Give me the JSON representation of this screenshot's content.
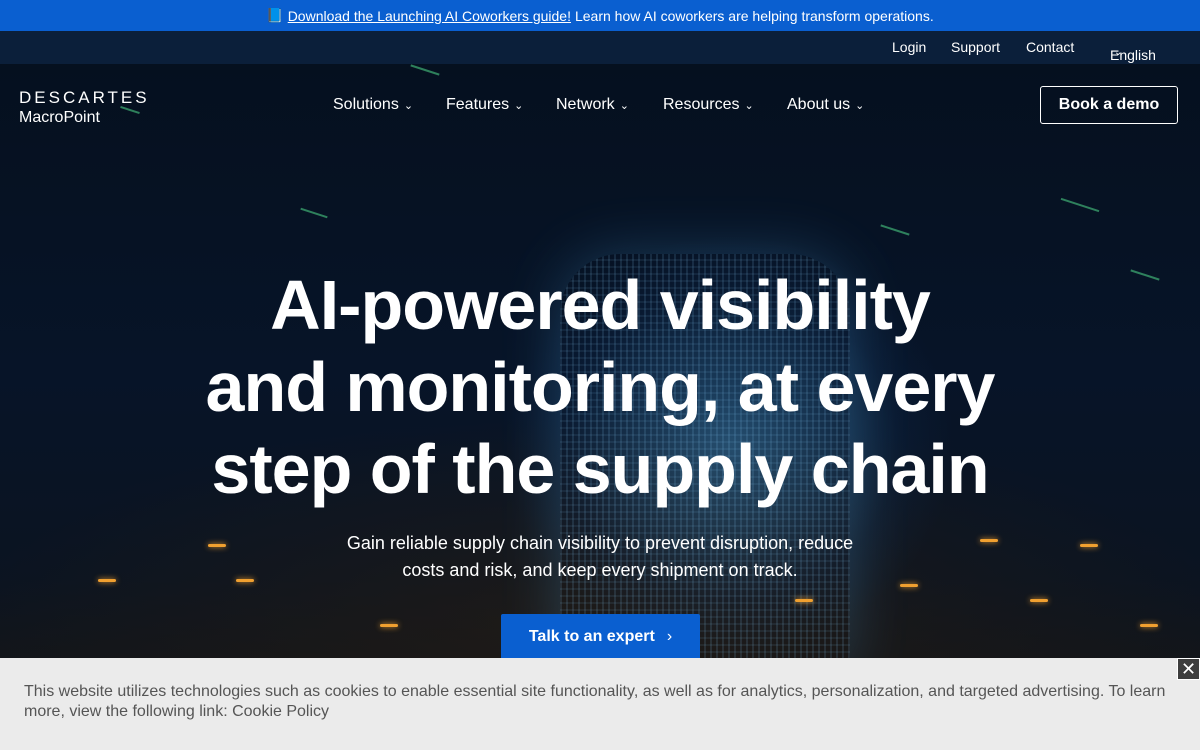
{
  "announcement": {
    "icon": "book-icon",
    "link_text": "Download the Launching AI Coworkers guide!",
    "text": "Learn how AI coworkers are helping transform operations."
  },
  "utility_nav": {
    "login": "Login",
    "support": "Support",
    "contact": "Contact",
    "language": "English"
  },
  "logo": {
    "line1": "DESCARTES",
    "line2": "MacroPoint"
  },
  "main_nav": {
    "items": [
      {
        "label": "Solutions"
      },
      {
        "label": "Features"
      },
      {
        "label": "Network"
      },
      {
        "label": "Resources"
      },
      {
        "label": "About us"
      }
    ],
    "cta": "Book a demo"
  },
  "hero": {
    "headline_line1": "AI-powered visibility",
    "headline_line2": "and monitoring, at every",
    "headline_line3": "step of the supply chain",
    "subtext_line1": "Gain reliable supply chain visibility to prevent disruption, reduce",
    "subtext_line2": "costs and risk, and keep every shipment on track.",
    "button": "Talk to an expert"
  },
  "cookie_banner": {
    "text": "This website utilizes technologies such as cookies to enable essential site functionality, as well as for analytics, personalization, and targeted advertising. To learn more, view the following link: Cookie Policy",
    "close": "✕"
  },
  "colors": {
    "brand_blue": "#0a5fd0",
    "utility_bar": "#0b1f3a",
    "cookie_bg": "#ebebeb"
  }
}
